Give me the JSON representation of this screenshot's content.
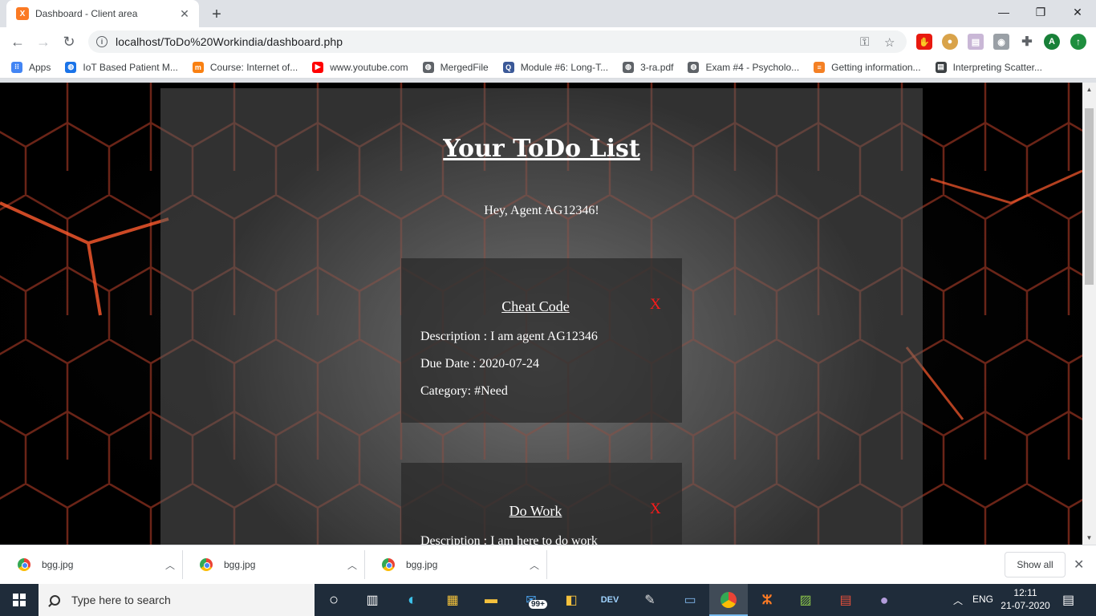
{
  "browser": {
    "tab_title": "Dashboard - Client area",
    "tab_favicon_letter": "X",
    "url": "localhost/ToDo%20Workindia/dashboard.php",
    "profile_initial": "A"
  },
  "bookmarks": [
    {
      "label": "Apps",
      "icon": "apps-grid-icon",
      "color": "#4285f4"
    },
    {
      "label": "IoT Based Patient M...",
      "icon": "globe-icon",
      "color": "#1a73e8"
    },
    {
      "label": "Course: Internet of...",
      "icon": "moodle-icon",
      "color": "#f98012"
    },
    {
      "label": "www.youtube.com",
      "icon": "youtube-icon",
      "color": "#ff0000"
    },
    {
      "label": "MergedFile",
      "icon": "globe-icon",
      "color": "#5f6368"
    },
    {
      "label": "Module #6: Long-T...",
      "icon": "q-icon",
      "color": "#3b5998"
    },
    {
      "label": "3-ra.pdf",
      "icon": "globe-icon",
      "color": "#5f6368"
    },
    {
      "label": "Exam #4 - Psycholo...",
      "icon": "globe-icon",
      "color": "#5f6368"
    },
    {
      "label": "Getting information...",
      "icon": "stackoverflow-icon",
      "color": "#f48024"
    },
    {
      "label": "Interpreting Scatter...",
      "icon": "document-icon",
      "color": "#3c4043"
    }
  ],
  "page": {
    "title": "Your ToDo List",
    "greeting": "Hey, Agent AG12346!",
    "delete_label": "X",
    "todos": [
      {
        "title": "Cheat Code",
        "description": "Description : I am agent AG12346",
        "due_date": "Due Date : 2020-07-24",
        "category": "Category: #Need"
      },
      {
        "title": "Do Work",
        "description": "Description : I am here to do work",
        "due_date": "",
        "category": ""
      }
    ]
  },
  "downloads": {
    "items": [
      "bgg.jpg",
      "bgg.jpg",
      "bgg.jpg"
    ],
    "show_all": "Show all"
  },
  "taskbar": {
    "search_placeholder": "Type here to search",
    "mail_badge": "99+",
    "language": "ENG",
    "time": "12:11",
    "date": "21-07-2020"
  }
}
